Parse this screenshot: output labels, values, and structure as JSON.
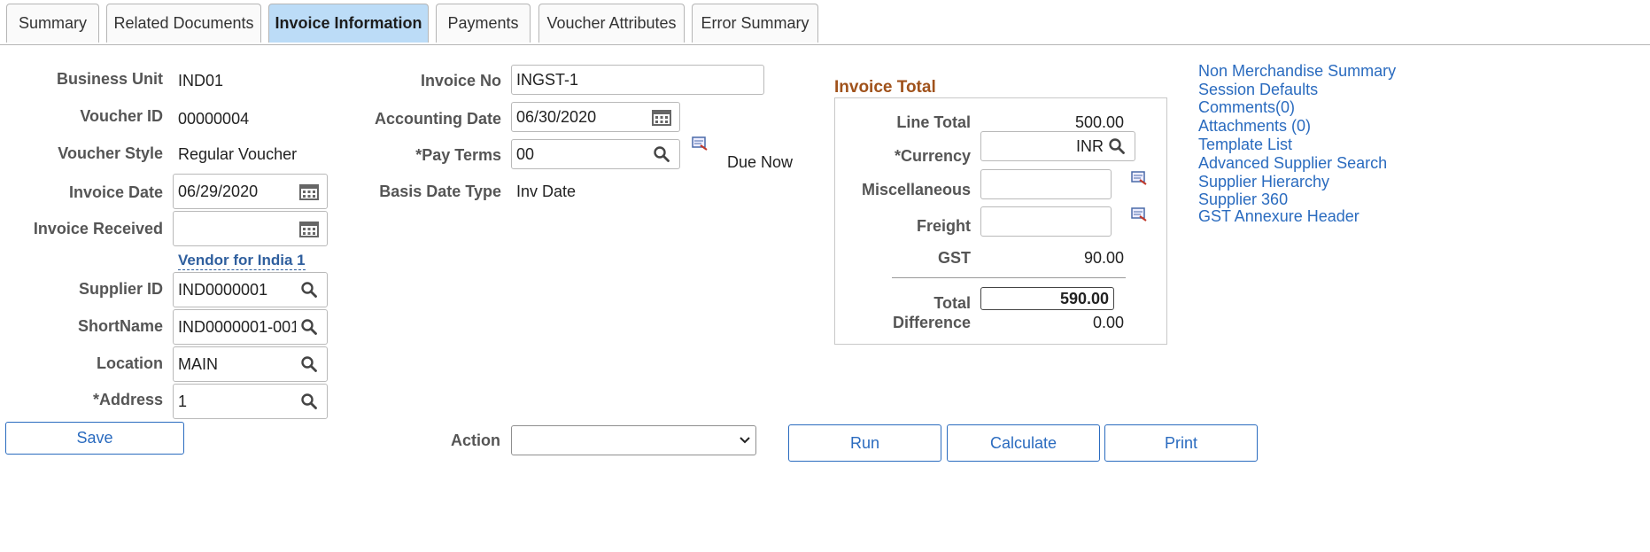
{
  "tabs": [
    {
      "label": "Summary"
    },
    {
      "label": "Related Documents"
    },
    {
      "label": "Invoice Information"
    },
    {
      "label": "Payments"
    },
    {
      "label": "Voucher Attributes"
    },
    {
      "label": "Error Summary"
    }
  ],
  "left": {
    "business_unit_label": "Business Unit",
    "business_unit_value": "IND01",
    "voucher_id_label": "Voucher ID",
    "voucher_id_value": "00000004",
    "voucher_style_label": "Voucher Style",
    "voucher_style_value": "Regular Voucher",
    "invoice_date_label": "Invoice Date",
    "invoice_date_value": "06/29/2020",
    "invoice_received_label": "Invoice Received",
    "invoice_received_value": "",
    "vendor_link": "Vendor for India 1",
    "supplier_id_label": "Supplier ID",
    "supplier_id_value": "IND0000001",
    "shortname_label": "ShortName",
    "shortname_value": "IND0000001-001",
    "location_label": "Location",
    "location_value": "MAIN",
    "address_label": "*Address",
    "address_value": "1"
  },
  "middle": {
    "invoice_no_label": "Invoice No",
    "invoice_no_value": "INGST-1",
    "accounting_date_label": "Accounting Date",
    "accounting_date_value": "06/30/2020",
    "pay_terms_label": "*Pay Terms",
    "pay_terms_value": "00",
    "due_text": "Due Now",
    "basis_date_type_label": "Basis Date Type",
    "basis_date_type_value": "Inv Date"
  },
  "invoice_total": {
    "title": "Invoice Total",
    "line_total_label": "Line Total",
    "line_total_value": "500.00",
    "currency_label": "*Currency",
    "currency_value": "INR",
    "misc_label": "Miscellaneous",
    "misc_value": "",
    "freight_label": "Freight",
    "freight_value": "",
    "gst_label": "GST",
    "gst_value": "90.00",
    "total_label": "Total",
    "total_value": "590.00",
    "difference_label": "Difference",
    "difference_value": "0.00"
  },
  "links": [
    "Non Merchandise Summary",
    "Session Defaults",
    "Comments(0)",
    "Attachments (0)",
    "Template List",
    "Advanced Supplier Search",
    "Supplier Hierarchy",
    "Supplier 360",
    "GST Annexure Header"
  ],
  "footer": {
    "save_label": "Save",
    "action_label": "Action",
    "action_value": "",
    "run_label": "Run",
    "calculate_label": "Calculate",
    "print_label": "Print"
  },
  "colors": {
    "active_tab": "#bcdcf7",
    "link": "#2a6bbf",
    "section_title": "#a0521b"
  }
}
